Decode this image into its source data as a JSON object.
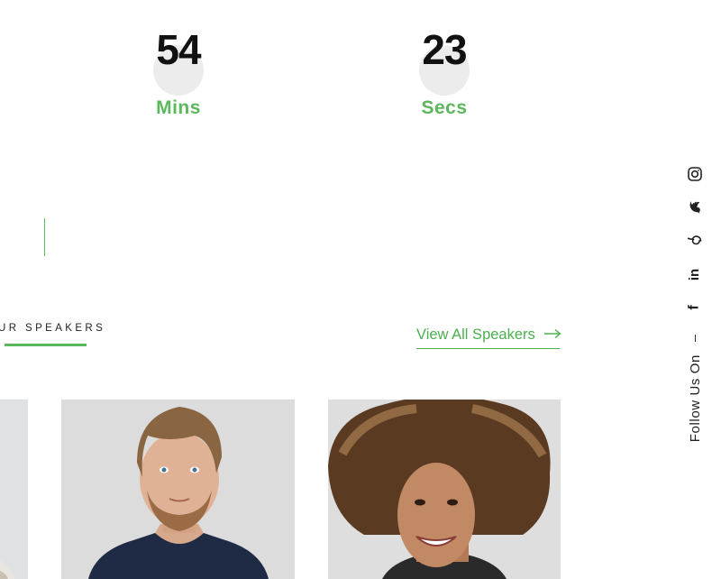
{
  "countdown": [
    {
      "value": "54",
      "unit": "Mins"
    },
    {
      "value": "23",
      "unit": "Secs"
    }
  ],
  "speakers": {
    "section_label": "UR SPEAKERS",
    "view_all_label": "View All Speakers"
  },
  "social": {
    "icons": [
      "instagram-icon",
      "twitter-icon",
      "pinterest-icon",
      "linkedin-icon",
      "facebook-icon"
    ],
    "follow_label": "Follow Us On"
  },
  "colors": {
    "accent": "#5cb85c",
    "text": "#111111",
    "circle": "#ececec"
  }
}
